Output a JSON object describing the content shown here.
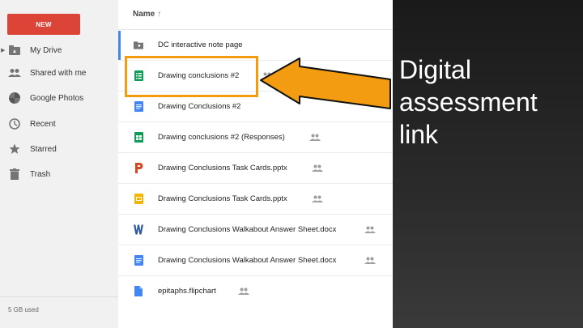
{
  "sidebar": {
    "new_label": "NEW",
    "items": [
      {
        "label": "My Drive",
        "icon": "drive-icon"
      },
      {
        "label": "Shared with me",
        "icon": "people-icon"
      },
      {
        "label": "Google Photos",
        "icon": "photos-icon"
      },
      {
        "label": "Recent",
        "icon": "clock-icon"
      },
      {
        "label": "Starred",
        "icon": "star-icon"
      },
      {
        "label": "Trash",
        "icon": "trash-icon"
      }
    ],
    "storage": "5 GB used"
  },
  "list": {
    "column_header": "Name",
    "sort_arrow": "↑",
    "files": [
      {
        "name": "DC interactive note page",
        "icon": "folder-icon",
        "shared": false
      },
      {
        "name": "Drawing conclusions #2",
        "icon": "google-forms-icon",
        "shared": true
      },
      {
        "name": "Drawing Conclusions #2",
        "icon": "google-docs-icon",
        "shared": false
      },
      {
        "name": "Drawing conclusions #2 (Responses)",
        "icon": "google-sheets-icon",
        "shared": true
      },
      {
        "name": "Drawing Conclusions Task Cards.pptx",
        "icon": "powerpoint-icon",
        "shared": true
      },
      {
        "name": "Drawing Conclusions Task Cards.pptx",
        "icon": "google-slides-icon",
        "shared": true
      },
      {
        "name": "Drawing Conclusions Walkabout Answer Sheet.docx",
        "icon": "word-icon",
        "shared": true
      },
      {
        "name": "Drawing Conclusions Walkabout Answer Sheet.docx",
        "icon": "google-docs-icon",
        "shared": true
      },
      {
        "name": "epitaphs.flipchart",
        "icon": "file-icon",
        "shared": true
      }
    ]
  },
  "annotation": {
    "text": "Digital assessment link",
    "color": "#f39c12"
  }
}
